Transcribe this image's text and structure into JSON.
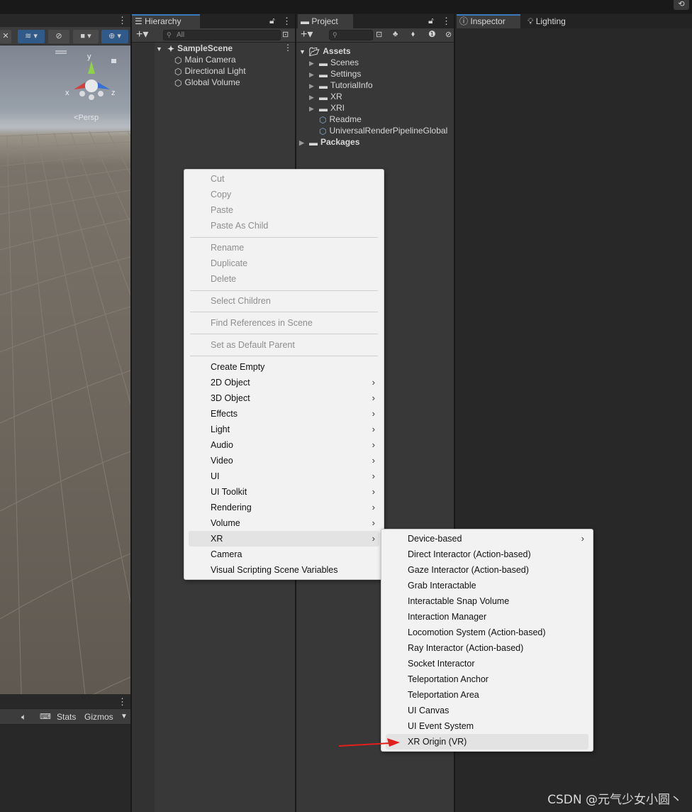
{
  "colors": {
    "accent": "#3a79bb",
    "menu_bg": "#f2f2f2",
    "arrow": "#e0201c"
  },
  "history_icon": "history-icon",
  "scene": {
    "gizmo": {
      "y": "y",
      "x": "x",
      "z": "z"
    },
    "persp_label": "Persp",
    "bottom": {
      "stats": "Stats",
      "gizmos": "Gizmos"
    }
  },
  "hierarchy": {
    "tab_label": "Hierarchy",
    "search_placeholder": "All",
    "scene_name": "SampleScene",
    "objects": [
      "Main Camera",
      "Directional Light",
      "Global Volume"
    ]
  },
  "project": {
    "tab_label": "Project",
    "assets_label": "Assets",
    "folders": [
      "Scenes",
      "Settings",
      "TutorialInfo",
      "XR",
      "XRI"
    ],
    "files": [
      "Readme",
      "UniversalRenderPipelineGlobal"
    ],
    "packages_label": "Packages"
  },
  "inspector": {
    "tab_label": "Inspector",
    "lighting_tab_label": "Lighting"
  },
  "context_menu": {
    "group1": [
      "Cut",
      "Copy",
      "Paste",
      "Paste As Child"
    ],
    "group2": [
      "Rename",
      "Duplicate",
      "Delete"
    ],
    "select_children": "Select Children",
    "find_references": "Find References in Scene",
    "set_default_parent": "Set as Default Parent",
    "create_items": [
      "Create Empty",
      "2D Object",
      "3D Object",
      "Effects",
      "Light",
      "Audio",
      "Video",
      "UI",
      "UI Toolkit",
      "Rendering",
      "Volume",
      "XR",
      "Camera",
      "Visual Scripting Scene Variables"
    ]
  },
  "xr_submenu": {
    "items": [
      "Device-based",
      "Direct Interactor (Action-based)",
      "Gaze Interactor (Action-based)",
      "Grab Interactable",
      "Interactable Snap Volume",
      "Interaction Manager",
      "Locomotion System (Action-based)",
      "Ray Interactor (Action-based)",
      "Socket Interactor",
      "Teleportation Anchor",
      "Teleportation Area",
      "UI Canvas",
      "UI Event System",
      "XR Origin (VR)"
    ]
  },
  "watermark": "CSDN @元气少女小圆丶"
}
